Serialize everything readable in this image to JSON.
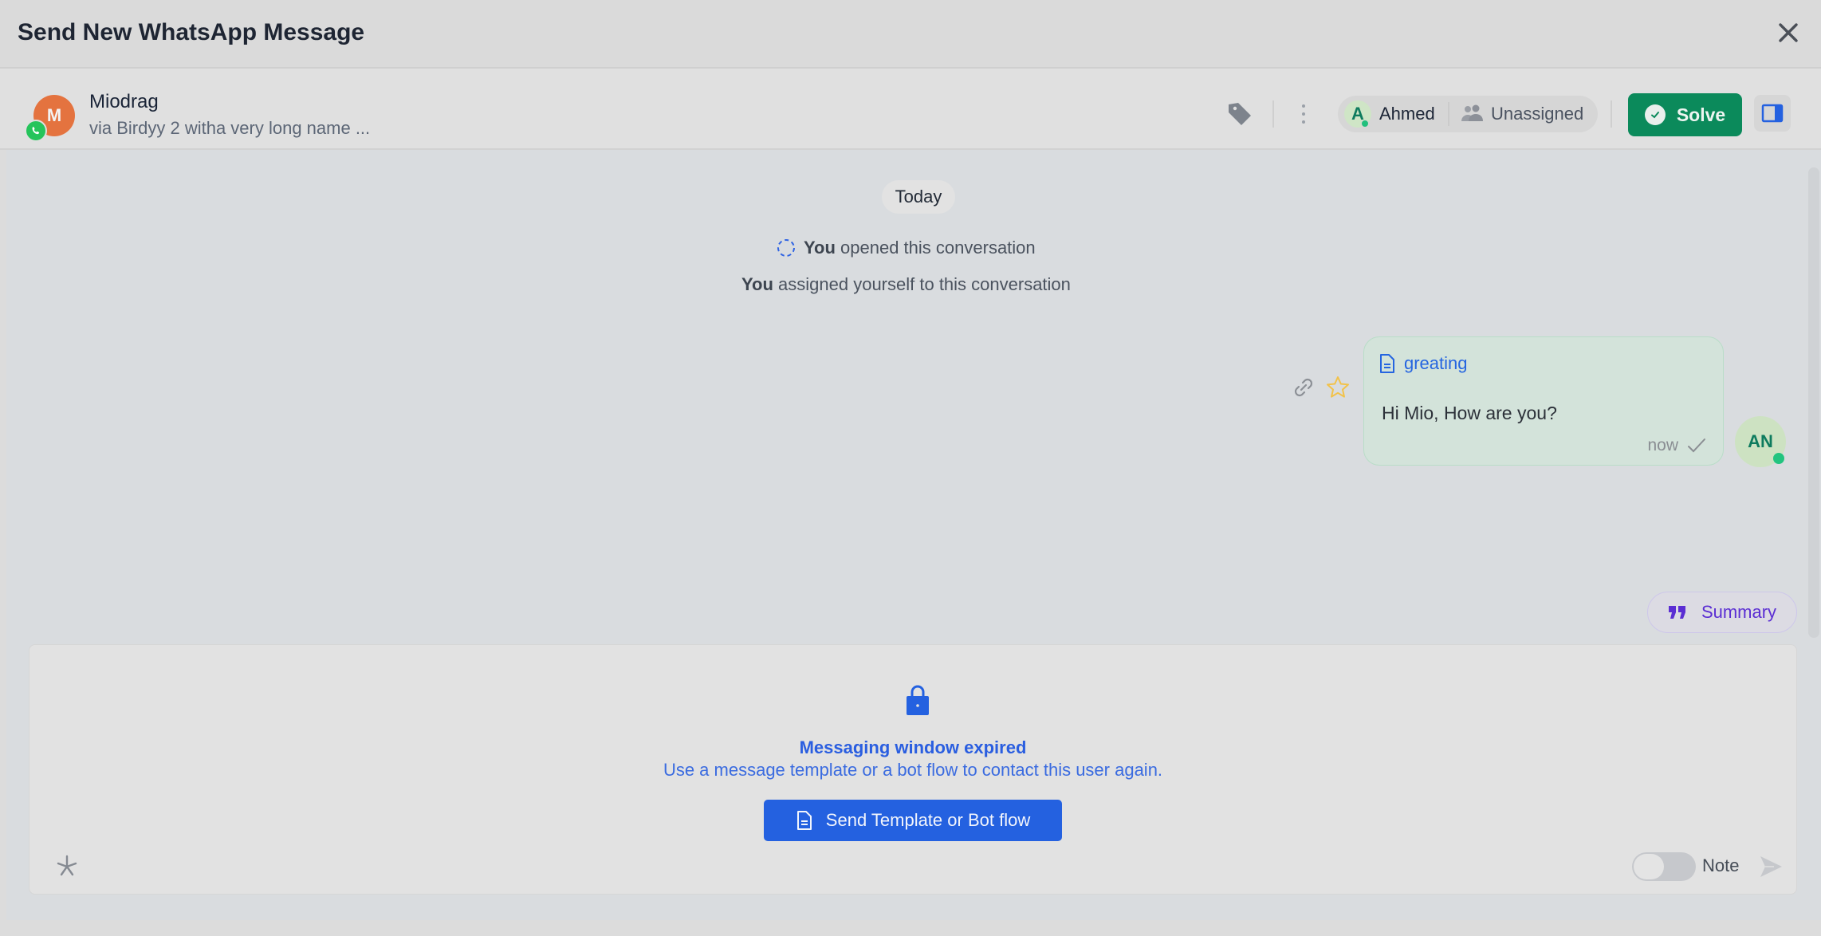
{
  "window": {
    "title": "Send New WhatsApp Message",
    "close_icon": "close-icon"
  },
  "contact": {
    "initial": "M",
    "name": "Miodrag",
    "channel": "via Birdyy 2 witha very long name ...",
    "channel_icon": "whatsapp-icon",
    "avatar_color": "#e4733f"
  },
  "toolbar": {
    "tag_icon": "tag-icon",
    "more_icon": "kebab-icon",
    "agent": {
      "initial": "A",
      "name": "Ahmed",
      "online": true
    },
    "team": {
      "name": "Unassigned",
      "icon": "users-icon"
    },
    "solve_label": "Solve",
    "solve_color": "#0b8a5b",
    "panel_icon": "sidebar-toggle-icon"
  },
  "chat": {
    "date_separator": "Today",
    "events": [
      {
        "actor": "You",
        "text": " opened this conversation",
        "icon": "dashed-circle-icon"
      },
      {
        "actor": "You",
        "text": " assigned yourself to this conversation"
      }
    ],
    "messages": [
      {
        "template_name": "greating",
        "text": "Hi Mio, How are you?",
        "time": "now",
        "status": "sent",
        "sender_initials": "AN",
        "sender_online": true
      }
    ],
    "summary_label": "Summary"
  },
  "composer": {
    "expired_title": "Messaging window expired",
    "expired_subtitle": "Use a message template or a bot flow to contact this user again.",
    "send_template_label": "Send Template or Bot flow",
    "note_label": "Note",
    "note_enabled": false,
    "accent": "#2461e0"
  }
}
